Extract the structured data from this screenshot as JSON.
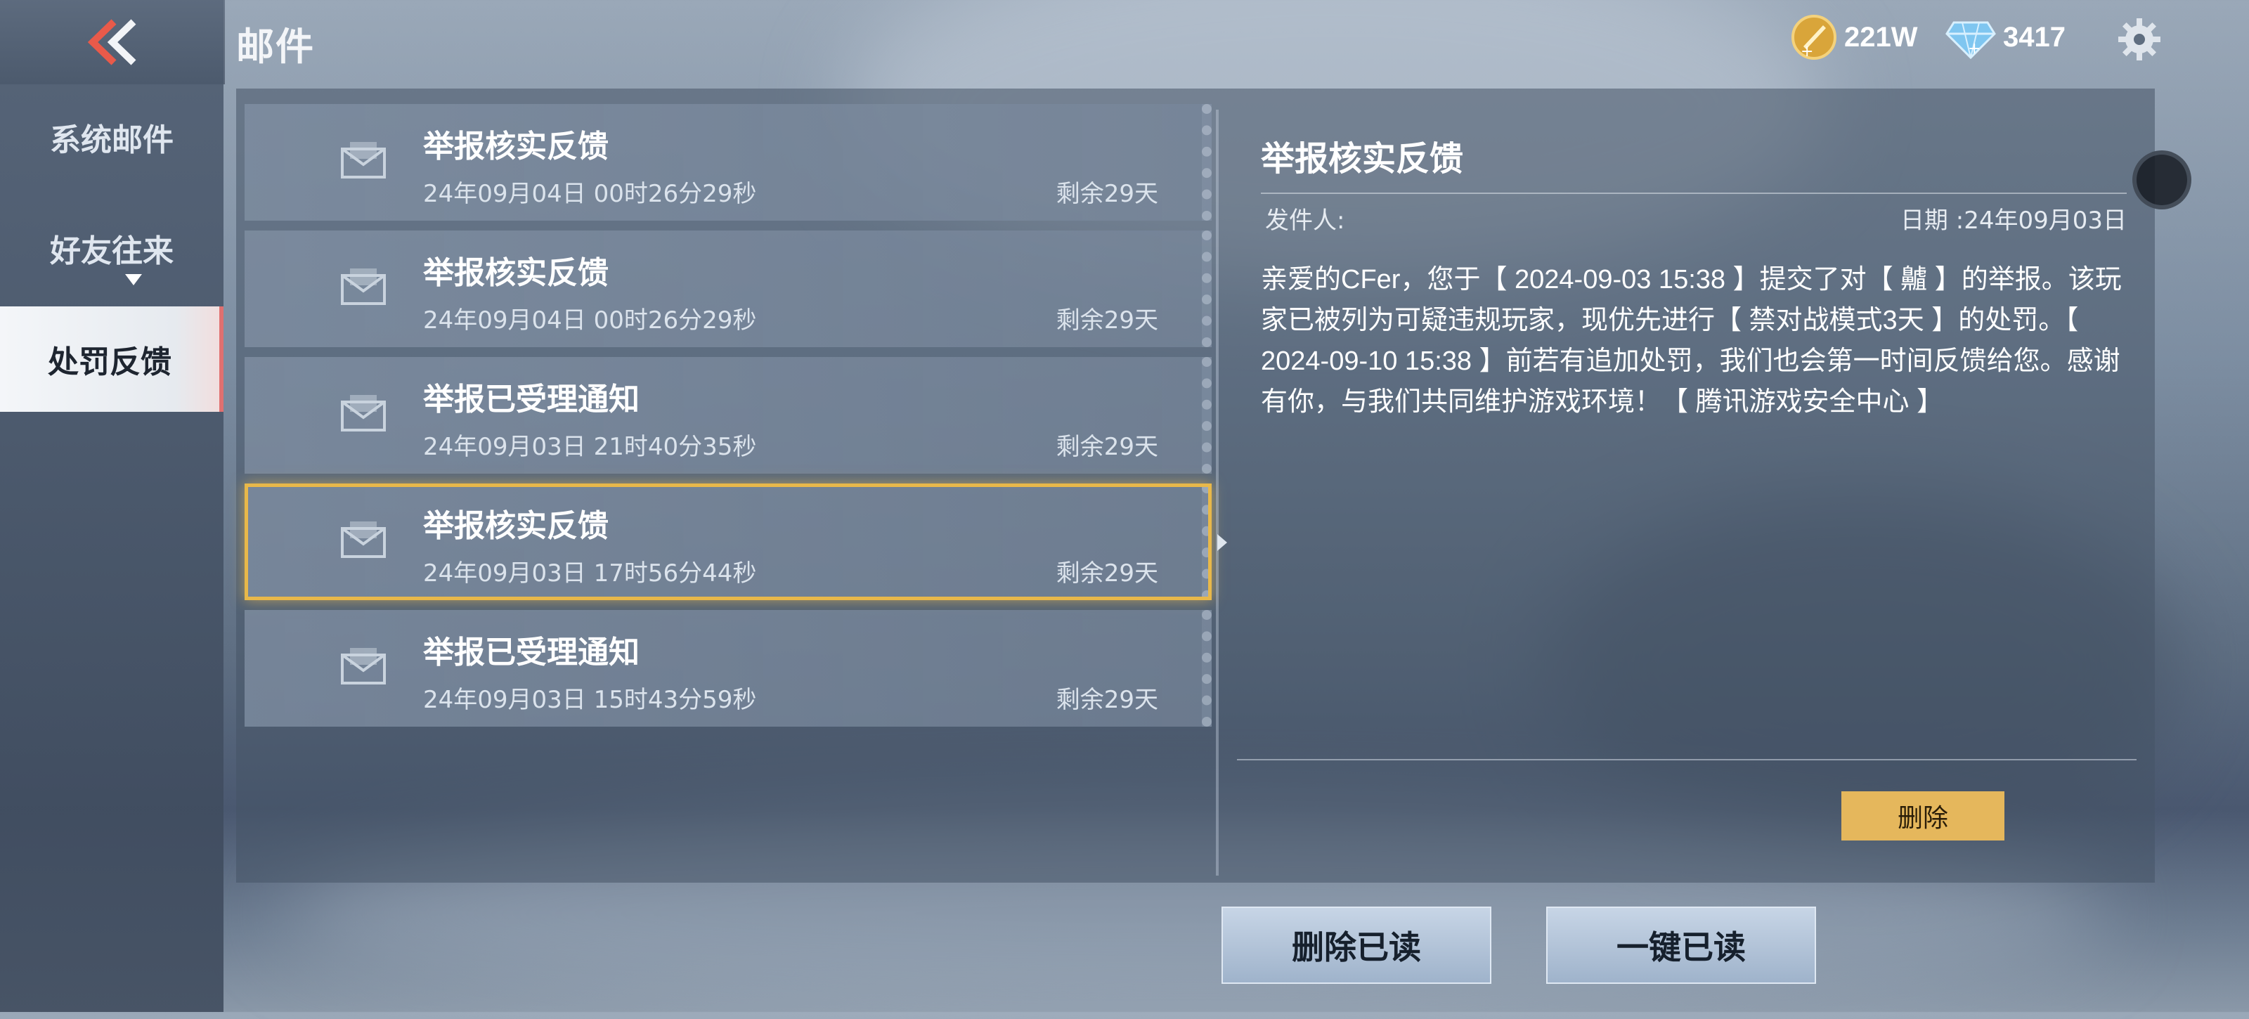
{
  "header": {
    "title": "邮件",
    "gold_amount": "221W",
    "diamond_amount": "3417"
  },
  "sidebar": {
    "items": [
      {
        "label": "系统邮件"
      },
      {
        "label": "好友往来"
      },
      {
        "label": "处罚反馈"
      }
    ],
    "active_index": 2
  },
  "mails": [
    {
      "title": "举报核实反馈",
      "time": "24年09月04日 00时26分29秒",
      "remain": "剩余29天"
    },
    {
      "title": "举报核实反馈",
      "time": "24年09月04日 00时26分29秒",
      "remain": "剩余29天"
    },
    {
      "title": "举报已受理通知",
      "time": "24年09月03日 21时40分35秒",
      "remain": "剩余29天"
    },
    {
      "title": "举报核实反馈",
      "time": "24年09月03日 17时56分44秒",
      "remain": "剩余29天"
    },
    {
      "title": "举报已受理通知",
      "time": "24年09月03日 15时43分59秒",
      "remain": "剩余29天"
    }
  ],
  "selected_mail_index": 3,
  "detail": {
    "title": "举报核实反馈",
    "sender_label": "发件人:",
    "date_label": "日期 :24年09月03日",
    "body": "亲爱的CFer，您于【 2024-09-03 15:38 】提交了对【 齇 】的举报。该玩家已被列为可疑违规玩家，现优先进行【 禁对战模式3天 】的处罚。【 2024-09-10 15:38 】前若有追加处罚，我们也会第一时间反馈给您。感谢有你，与我们共同维护游戏环境！【 腾讯游戏安全中心 】",
    "delete_label": "删除"
  },
  "footer": {
    "delete_read_label": "删除已读",
    "mark_all_read_label": "一键已读"
  },
  "colors": {
    "accent_gold": "#e5b75c",
    "selected_outline": "#e8b84a",
    "active_tab_marker": "#e07070"
  },
  "icons": [
    "back-chevron-icon",
    "gold-coin-icon",
    "diamond-icon",
    "gear-icon",
    "envelope-icon"
  ]
}
